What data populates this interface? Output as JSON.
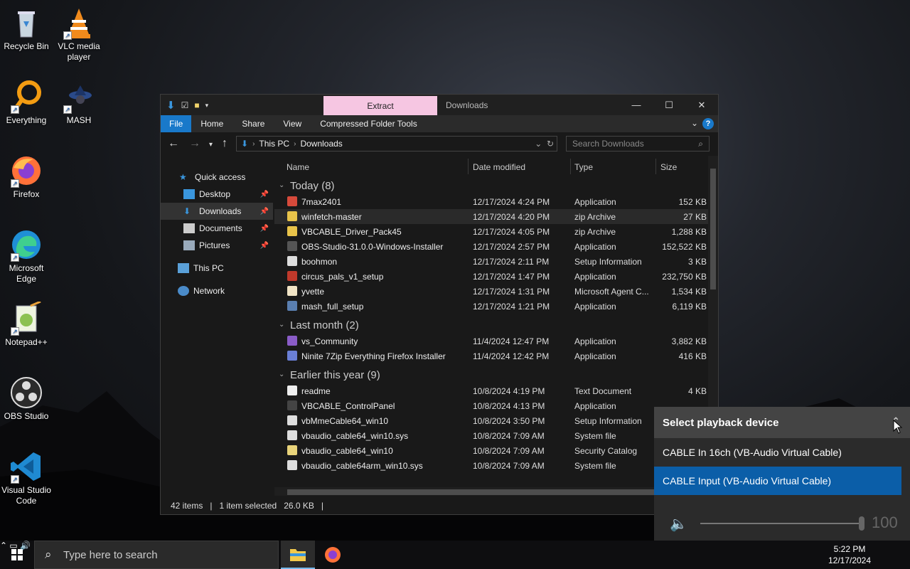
{
  "desktop": {
    "icons": [
      {
        "label": "Recycle Bin",
        "icon": "recycle-bin-icon"
      },
      {
        "label": "VLC media player",
        "icon": "vlc-icon"
      },
      {
        "label": "Everything",
        "icon": "everything-icon"
      },
      {
        "label": "MASH",
        "icon": "mash-icon"
      },
      {
        "label": "Firefox",
        "icon": "firefox-icon"
      },
      {
        "label": "Microsoft Edge",
        "icon": "edge-icon"
      },
      {
        "label": "Notepad++",
        "icon": "notepadpp-icon"
      },
      {
        "label": "OBS Studio",
        "icon": "obs-icon"
      },
      {
        "label": "Visual Studio Code",
        "icon": "vscode-icon"
      }
    ]
  },
  "explorer": {
    "contextual_tab": "Extract",
    "title": "Downloads",
    "ribbon_tabs": [
      "File",
      "Home",
      "Share",
      "View",
      "Compressed Folder Tools"
    ],
    "help": "?",
    "breadcrumb": [
      "This PC",
      "Downloads"
    ],
    "search_placeholder": "Search Downloads",
    "nav": {
      "quick_access": "Quick access",
      "desktop": "Desktop",
      "downloads": "Downloads",
      "documents": "Documents",
      "pictures": "Pictures",
      "this_pc": "This PC",
      "network": "Network"
    },
    "columns": {
      "name": "Name",
      "date": "Date modified",
      "type": "Type",
      "size": "Size"
    },
    "groups": [
      {
        "label": "Today (8)",
        "files": [
          {
            "name": "7max2401",
            "date": "12/17/2024 4:24 PM",
            "type": "Application",
            "size": "152 KB",
            "color": "#d64a3b"
          },
          {
            "name": "winfetch-master",
            "date": "12/17/2024 4:20 PM",
            "type": "zip Archive",
            "size": "27 KB",
            "color": "#e8c34a"
          },
          {
            "name": "VBCABLE_Driver_Pack45",
            "date": "12/17/2024 4:05 PM",
            "type": "zip Archive",
            "size": "1,288 KB",
            "color": "#e8c34a"
          },
          {
            "name": "OBS-Studio-31.0.0-Windows-Installer",
            "date": "12/17/2024 2:57 PM",
            "type": "Application",
            "size": "152,522 KB",
            "color": "#555555"
          },
          {
            "name": "boohmon",
            "date": "12/17/2024 2:11 PM",
            "type": "Setup Information",
            "size": "3 KB",
            "color": "#dddddd"
          },
          {
            "name": "circus_pals_v1_setup",
            "date": "12/17/2024 1:47 PM",
            "type": "Application",
            "size": "232,750 KB",
            "color": "#c0392b"
          },
          {
            "name": "yvette",
            "date": "12/17/2024 1:31 PM",
            "type": "Microsoft Agent C...",
            "size": "1,534 KB",
            "color": "#f1e4c6"
          },
          {
            "name": "mash_full_setup",
            "date": "12/17/2024 1:21 PM",
            "type": "Application",
            "size": "6,119 KB",
            "color": "#5a7fb0"
          }
        ]
      },
      {
        "label": "Last month (2)",
        "files": [
          {
            "name": "vs_Community",
            "date": "11/4/2024 12:47 PM",
            "type": "Application",
            "size": "3,882 KB",
            "color": "#8a5cc7"
          },
          {
            "name": "Ninite 7Zip Everything Firefox Installer",
            "date": "11/4/2024 12:42 PM",
            "type": "Application",
            "size": "416 KB",
            "color": "#6a7fd6"
          }
        ]
      },
      {
        "label": "Earlier this year (9)",
        "files": [
          {
            "name": "readme",
            "date": "10/8/2024 4:19 PM",
            "type": "Text Document",
            "size": "4 KB",
            "color": "#eeeeee"
          },
          {
            "name": "VBCABLE_ControlPanel",
            "date": "10/8/2024 4:13 PM",
            "type": "Application",
            "size": "",
            "color": "#444444"
          },
          {
            "name": "vbMmeCable64_win10",
            "date": "10/8/2024 3:50 PM",
            "type": "Setup Information",
            "size": "",
            "color": "#dddddd"
          },
          {
            "name": "vbaudio_cable64_win10.sys",
            "date": "10/8/2024 7:09 AM",
            "type": "System file",
            "size": "",
            "color": "#dddddd"
          },
          {
            "name": "vbaudio_cable64_win10",
            "date": "10/8/2024 7:09 AM",
            "type": "Security Catalog",
            "size": "",
            "color": "#e8d37a"
          },
          {
            "name": "vbaudio_cable64arm_win10.sys",
            "date": "10/8/2024 7:09 AM",
            "type": "System file",
            "size": "",
            "color": "#dddddd"
          }
        ]
      }
    ],
    "status": {
      "items": "42 items",
      "selected": "1 item selected",
      "size": "26.0 KB"
    }
  },
  "flyout": {
    "title": "Select playback device",
    "options": [
      "CABLE In 16ch (VB-Audio Virtual Cable)",
      "CABLE Input (VB-Audio Virtual Cable)"
    ],
    "selected_index": 1,
    "volume": "100"
  },
  "taskbar": {
    "search_placeholder": "Type here to search",
    "time": "5:22 PM",
    "date": "12/17/2024"
  }
}
